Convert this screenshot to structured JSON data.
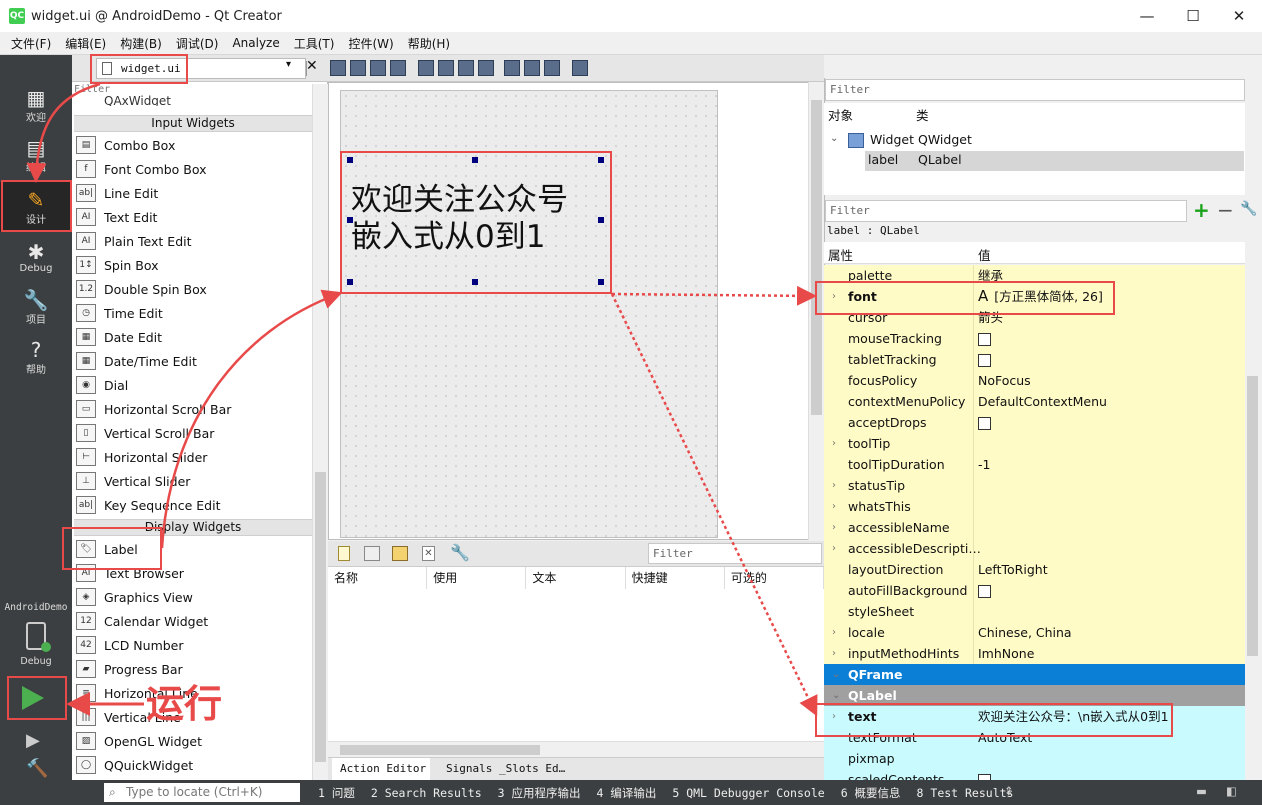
{
  "window": {
    "title": "widget.ui @ AndroidDemo - Qt Creator",
    "app_icon": "QC",
    "minimize": "—",
    "maximize": "☐",
    "close": "✕"
  },
  "menu": [
    "文件(F)",
    "编辑(E)",
    "构建(B)",
    "调试(D)",
    "Analyze",
    "工具(T)",
    "控件(W)",
    "帮助(H)"
  ],
  "modes": [
    {
      "label": "欢迎",
      "icon": "grid-icon"
    },
    {
      "label": "编辑",
      "icon": "edit-doc-icon"
    },
    {
      "label": "设计",
      "icon": "pencil-icon"
    },
    {
      "label": "Debug",
      "icon": "bug-icon"
    },
    {
      "label": "项目",
      "icon": "wrench-icon"
    },
    {
      "label": "帮助",
      "icon": "help-icon"
    }
  ],
  "kit": {
    "project": "AndroidDemo",
    "mode": "Debug"
  },
  "doc_tab": "widget.ui",
  "widget_filter": "Filter",
  "widget_partial_top": "QAxWidget",
  "categories": {
    "input": "Input Widgets",
    "display": "Display Widgets"
  },
  "input_widgets": [
    {
      "name": "Combo Box",
      "icon": "▤"
    },
    {
      "name": "Font Combo Box",
      "icon": "f"
    },
    {
      "name": "Line Edit",
      "icon": "ab|"
    },
    {
      "name": "Text Edit",
      "icon": "AI"
    },
    {
      "name": "Plain Text Edit",
      "icon": "AI"
    },
    {
      "name": "Spin Box",
      "icon": "1↕"
    },
    {
      "name": "Double Spin Box",
      "icon": "1.2"
    },
    {
      "name": "Time Edit",
      "icon": "◷"
    },
    {
      "name": "Date Edit",
      "icon": "▦"
    },
    {
      "name": "Date/Time Edit",
      "icon": "▦"
    },
    {
      "name": "Dial",
      "icon": "◉"
    },
    {
      "name": "Horizontal Scroll Bar",
      "icon": "▭"
    },
    {
      "name": "Vertical Scroll Bar",
      "icon": "▯"
    },
    {
      "name": "Horizontal Slider",
      "icon": "⊢"
    },
    {
      "name": "Vertical Slider",
      "icon": "⊥"
    },
    {
      "name": "Key Sequence Edit",
      "icon": "ab|"
    }
  ],
  "display_widgets": [
    {
      "name": "Label",
      "icon": "🏷"
    },
    {
      "name": "Text Browser",
      "icon": "AI"
    },
    {
      "name": "Graphics View",
      "icon": "◈"
    },
    {
      "name": "Calendar Widget",
      "icon": "12"
    },
    {
      "name": "LCD Number",
      "icon": "42"
    },
    {
      "name": "Progress Bar",
      "icon": "▰"
    },
    {
      "name": "Horizontal Line",
      "icon": "≡"
    },
    {
      "name": "Vertical Line",
      "icon": "|||"
    },
    {
      "name": "OpenGL Widget",
      "icon": "▨"
    },
    {
      "name": "QQuickWidget",
      "icon": "◯"
    }
  ],
  "form_label": {
    "line1": "欢迎关注公众号",
    "line2": "嵌入式从0到1"
  },
  "action_editor": {
    "filter": "Filter",
    "columns": [
      "名称",
      "使用",
      "文本",
      "快捷键",
      "可选的"
    ],
    "tabs": [
      "Action Editor",
      "Signals _Slots Ed…"
    ]
  },
  "object_inspector": {
    "filter": "Filter",
    "headers": [
      "对象",
      "类"
    ],
    "rows": [
      {
        "obj": "Widget",
        "cls": "QWidget"
      },
      {
        "obj": "label",
        "cls": "QLabel"
      }
    ]
  },
  "property_editor": {
    "filter": "Filter",
    "context": "label : QLabel",
    "headers": [
      "属性",
      "值"
    ],
    "rows": [
      {
        "k": "palette",
        "v": "继承",
        "style": "yel"
      },
      {
        "k": "font",
        "v": "[方正黑体简体, 26]",
        "style": "yel",
        "bold": true,
        "caret": true,
        "prefix": "A"
      },
      {
        "k": "cursor",
        "v": "箭头",
        "style": "yel"
      },
      {
        "k": "mouseTracking",
        "v": "",
        "style": "yel",
        "check": true
      },
      {
        "k": "tabletTracking",
        "v": "",
        "style": "yel",
        "check": true
      },
      {
        "k": "focusPolicy",
        "v": "NoFocus",
        "style": "yel"
      },
      {
        "k": "contextMenuPolicy",
        "v": "DefaultContextMenu",
        "style": "yel"
      },
      {
        "k": "acceptDrops",
        "v": "",
        "style": "yel",
        "check": true
      },
      {
        "k": "toolTip",
        "v": "",
        "style": "yel",
        "caret": true
      },
      {
        "k": "toolTipDuration",
        "v": "-1",
        "style": "yel"
      },
      {
        "k": "statusTip",
        "v": "",
        "style": "yel",
        "caret": true
      },
      {
        "k": "whatsThis",
        "v": "",
        "style": "yel",
        "caret": true
      },
      {
        "k": "accessibleName",
        "v": "",
        "style": "yel",
        "caret": true
      },
      {
        "k": "accessibleDescripti…",
        "v": "",
        "style": "yel",
        "caret": true
      },
      {
        "k": "layoutDirection",
        "v": "LeftToRight",
        "style": "yel"
      },
      {
        "k": "autoFillBackground",
        "v": "",
        "style": "yel",
        "check": true
      },
      {
        "k": "styleSheet",
        "v": "",
        "style": "yel"
      },
      {
        "k": "locale",
        "v": "Chinese, China",
        "style": "yel",
        "caret": true
      },
      {
        "k": "inputMethodHints",
        "v": "ImhNone",
        "style": "yel",
        "caret": true
      },
      {
        "k": "QFrame",
        "v": "",
        "style": "blue",
        "caret": true
      },
      {
        "k": "QLabel",
        "v": "",
        "style": "grey",
        "caret": true
      },
      {
        "k": "text",
        "v": "欢迎关注公众号：\\n嵌入式从0到1",
        "style": "cyan",
        "bold": true,
        "caret": true
      },
      {
        "k": "textFormat",
        "v": "AutoText",
        "style": "cyan"
      },
      {
        "k": "pixmap",
        "v": "",
        "style": "cyan"
      },
      {
        "k": "scaledContents",
        "v": "",
        "style": "cyan",
        "check": true
      }
    ]
  },
  "run_annotation": "运行",
  "statusbar": {
    "locate_placeholder": "Type to locate (Ctrl+K)",
    "items": [
      "1 问题",
      "2 Search Results",
      "3 应用程序输出",
      "4 编译输出",
      "5 QML Debugger Console",
      "6 概要信息",
      "8 Test Results"
    ]
  },
  "colors": {
    "annotation_red": "#e84a4a",
    "mode_active": "#f5a623",
    "qframe_blue": "#0b7fd6",
    "prop_yellow": "#fffbc6",
    "prop_cyan": "#c9fbfe"
  }
}
